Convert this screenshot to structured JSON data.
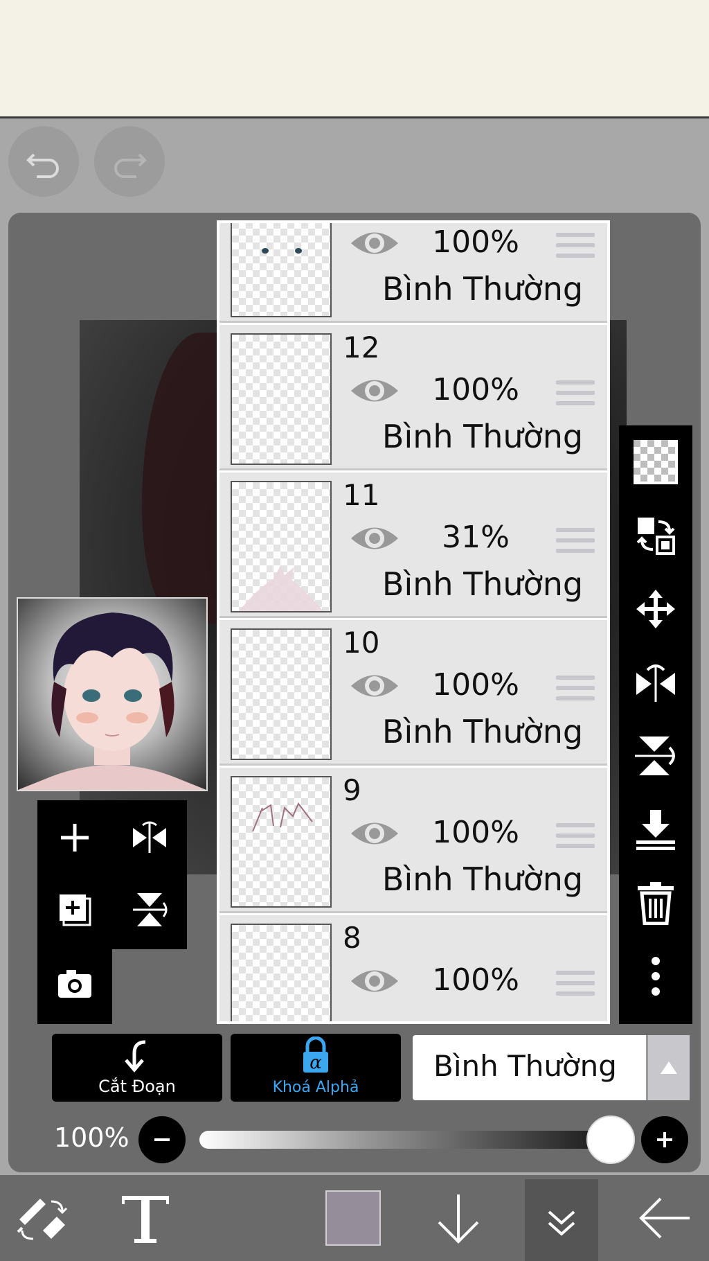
{
  "toolbar": {
    "undo_icon": "undo-icon",
    "redo_icon": "redo-icon"
  },
  "layers": [
    {
      "number": "",
      "opacity": "100%",
      "blend": "Bình Thường",
      "thumb": "eyes"
    },
    {
      "number": "12",
      "opacity": "100%",
      "blend": "Bình Thường",
      "thumb": "empty"
    },
    {
      "number": "11",
      "opacity": "31%",
      "blend": "Bình Thường",
      "thumb": "neck"
    },
    {
      "number": "10",
      "opacity": "100%",
      "blend": "Bình Thường",
      "thumb": "empty"
    },
    {
      "number": "9",
      "opacity": "100%",
      "blend": "Bình Thường",
      "thumb": "lines"
    },
    {
      "number": "8",
      "opacity": "100%",
      "blend": "",
      "thumb": "empty"
    }
  ],
  "actions": {
    "clipping_label": "Cắt Đoạn",
    "alpha_lock_label": "Khoá Alphả"
  },
  "blend_mode": {
    "selected": "Bình Thường"
  },
  "opacity_slider": {
    "label": "100%",
    "value": 1.0
  },
  "colors": {
    "current_color": "#958d9a",
    "accent_blue": "#3aa7f0"
  }
}
